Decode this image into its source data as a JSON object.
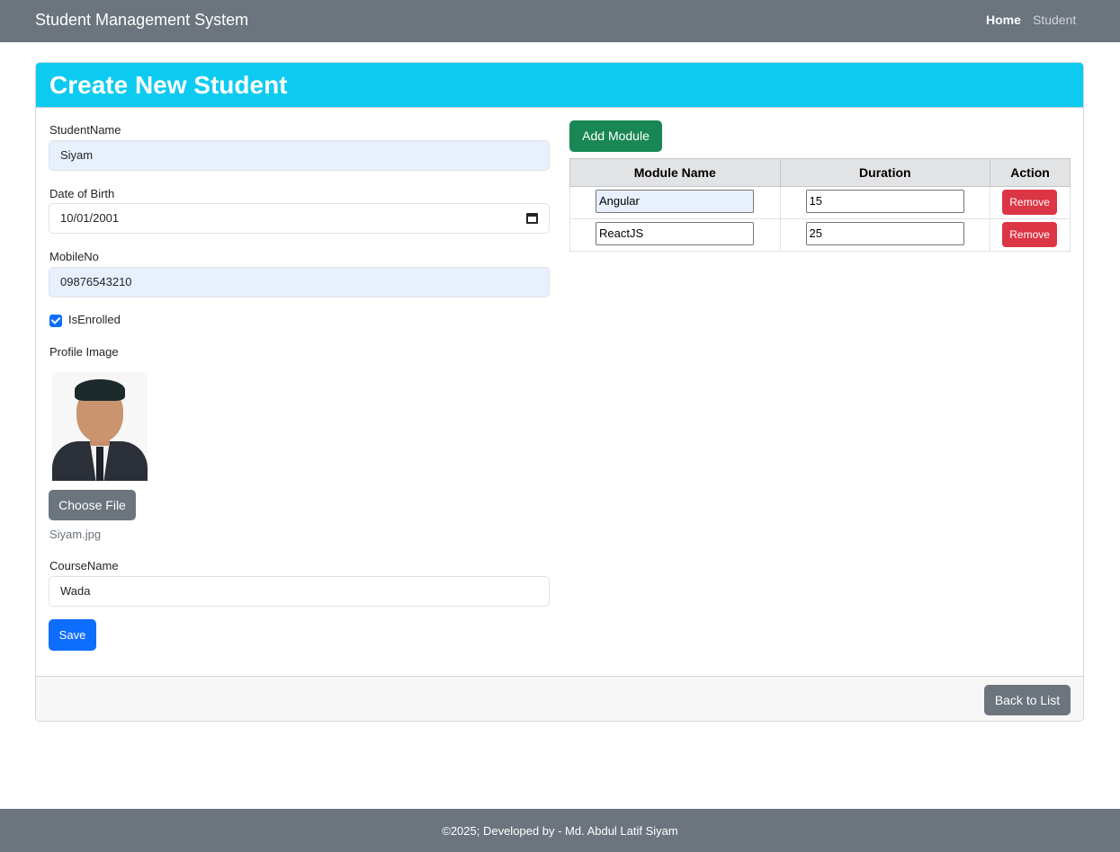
{
  "navbar": {
    "brand": "Student Management System",
    "links": [
      "Home",
      "Student"
    ]
  },
  "form": {
    "title": "Create New Student",
    "student_name": {
      "label": "StudentName",
      "value": "Siyam"
    },
    "dob": {
      "label": "Date of Birth",
      "value": "10/01/2001"
    },
    "mobile": {
      "label": "MobileNo",
      "value": "09876543210"
    },
    "enrolled": {
      "label": "IsEnrolled",
      "checked": true
    },
    "profile_image": {
      "label": "Profile Image",
      "choose_label": "Choose File",
      "file_name": "Siyam.jpg"
    },
    "course": {
      "label": "CourseName",
      "value": "Wada"
    },
    "save_label": "Save"
  },
  "modules": {
    "add_label": "Add Module",
    "columns": [
      "Module Name",
      "Duration",
      "Action"
    ],
    "rows": [
      {
        "name": "Angular",
        "duration": "15",
        "action": "Remove"
      },
      {
        "name": "ReactJS",
        "duration": "25",
        "action": "Remove"
      }
    ]
  },
  "card_footer": {
    "back_label": "Back to List"
  },
  "footer": {
    "text": "©2025; Developed by - Md. Abdul Latif Siyam"
  },
  "colors": {
    "navbar": "#6c757d",
    "header": "#0dcaf0",
    "primary": "#0d6efd",
    "success": "#198754",
    "danger": "#dc3545",
    "secondary": "#6c757d"
  }
}
